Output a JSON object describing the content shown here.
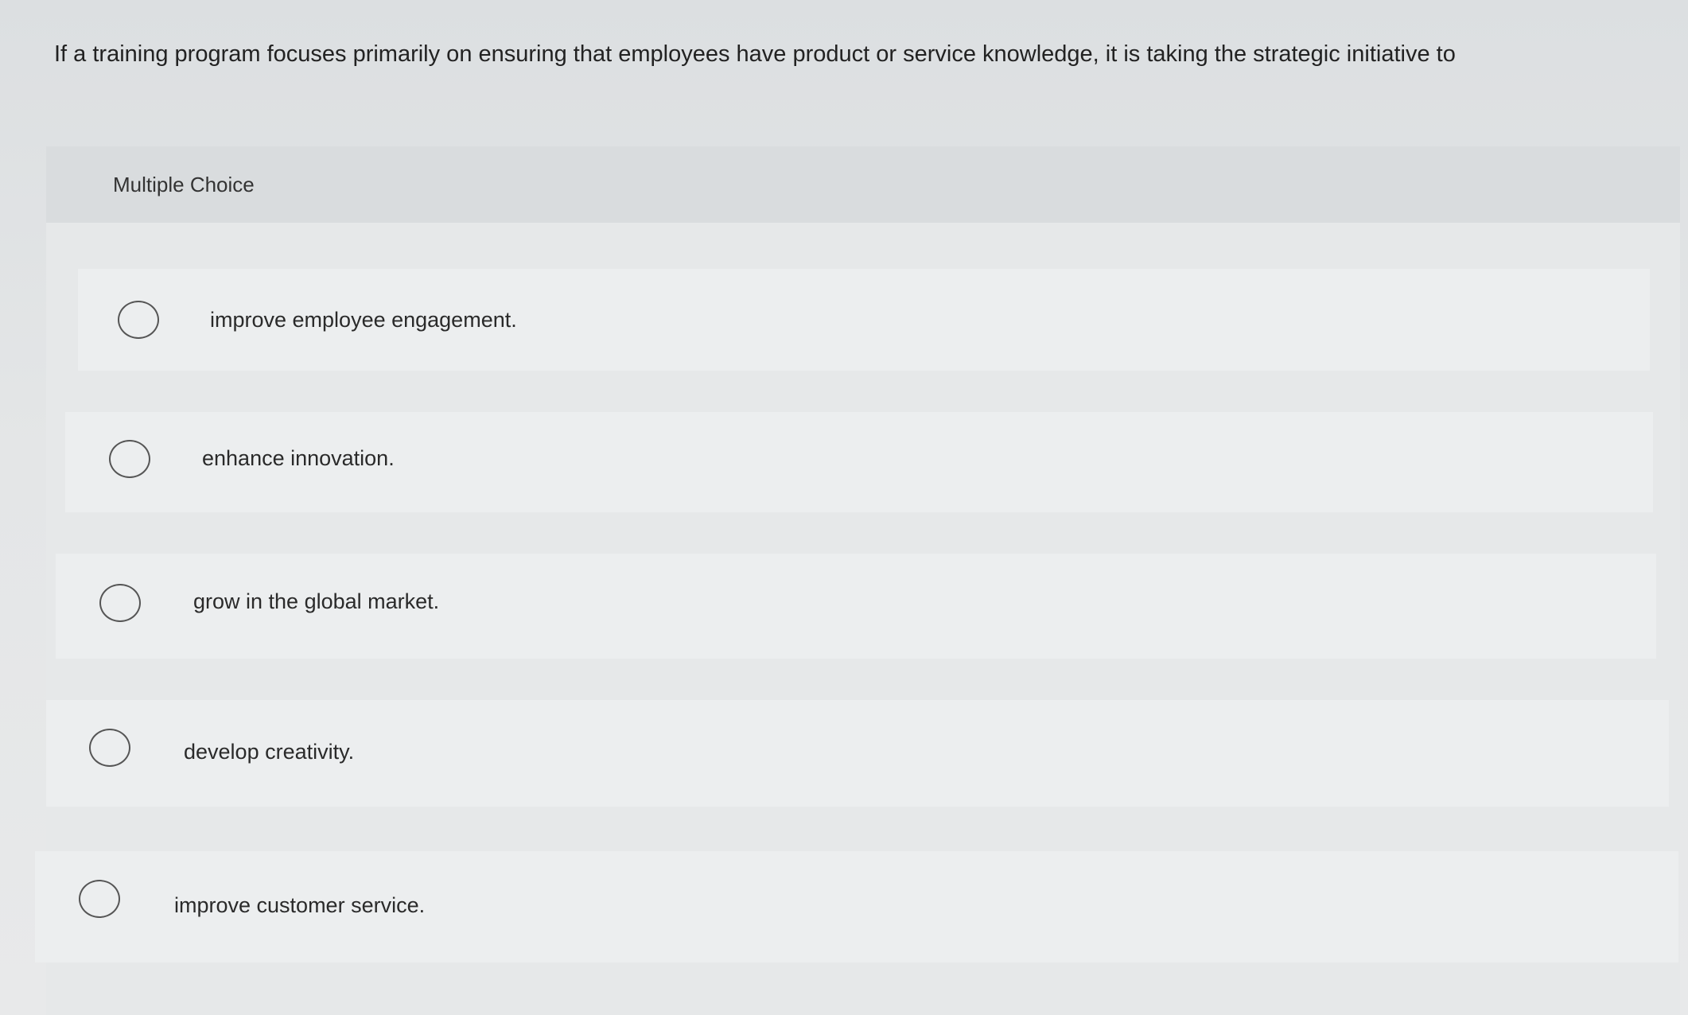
{
  "question": {
    "text": "If a training program focuses primarily on ensuring that employees have product or service knowledge, it is taking the strategic initiative to"
  },
  "multiple_choice": {
    "header_label": "Multiple Choice",
    "options": [
      {
        "label": "improve employee engagement.",
        "selected": false
      },
      {
        "label": "enhance innovation.",
        "selected": false
      },
      {
        "label": "grow in the global market.",
        "selected": false
      },
      {
        "label": "develop creativity.",
        "selected": false
      },
      {
        "label": "improve customer service.",
        "selected": false
      }
    ]
  },
  "colors": {
    "background": "#e4e6e7",
    "header_band": "#d9dcde",
    "option_row": "#eceeef",
    "radio_border": "#555555",
    "text": "#222222"
  }
}
